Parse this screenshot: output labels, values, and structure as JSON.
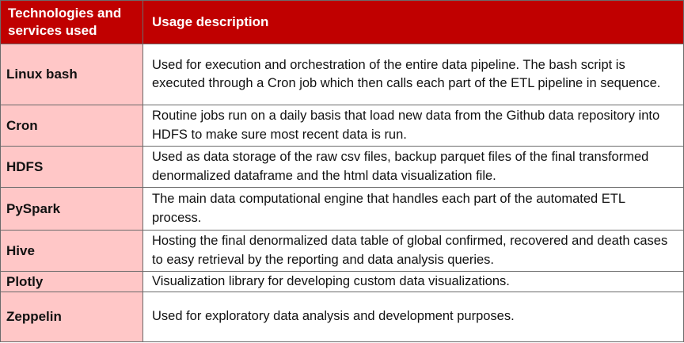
{
  "table": {
    "header": {
      "name_label": "Technologies and services used",
      "desc_label": "Usage description"
    },
    "rows": [
      {
        "name": "Linux bash",
        "description": "Used for execution and orchestration of the entire data pipeline. The bash script is executed through a Cron job which then calls each part of the ETL pipeline in sequence."
      },
      {
        "name": "Cron",
        "description": "Routine jobs run on a daily basis that load new data from the Github data repository into HDFS to make sure most recent data is run."
      },
      {
        "name": "HDFS",
        "description": "Used as data storage of the raw csv files, backup parquet files of the final transformed denormalized dataframe and the html data visualization file."
      },
      {
        "name": "PySpark",
        "description": "The main data computational engine that handles each part of the automated ETL process."
      },
      {
        "name": "Hive",
        "description": "Hosting the final denormalized data table of global confirmed, recovered and death cases to easy retrieval by the reporting and data analysis queries."
      },
      {
        "name": "Plotly",
        "description": "Visualization library for developing custom data visualizations."
      },
      {
        "name": "Zeppelin",
        "description": "Used for exploratory data analysis and development purposes."
      }
    ]
  }
}
